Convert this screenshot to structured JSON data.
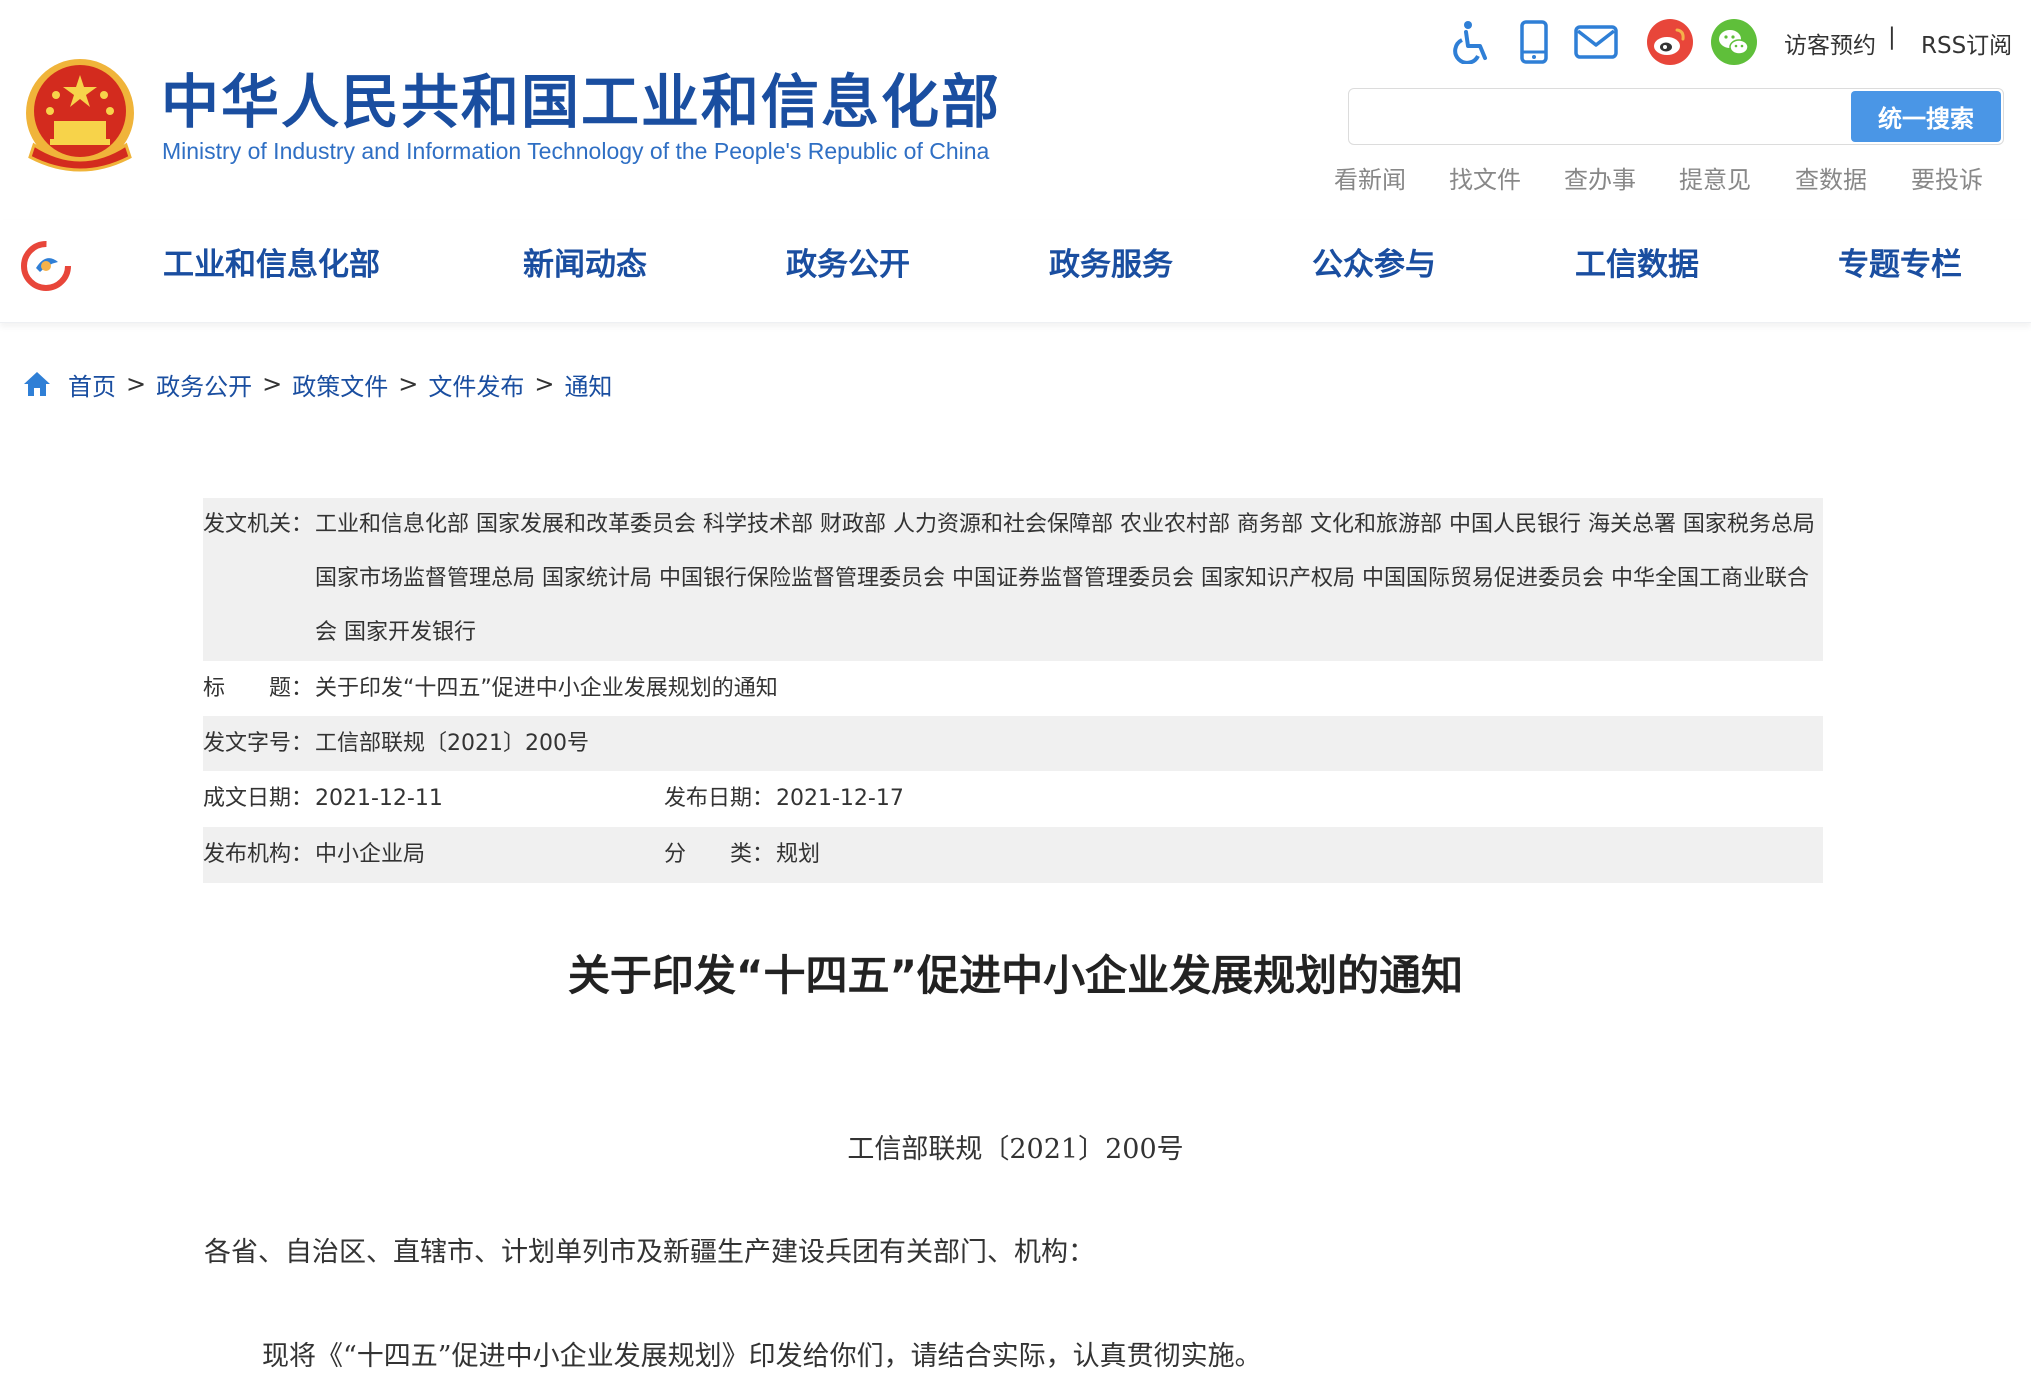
{
  "header": {
    "title": "中华人民共和国工业和信息化部",
    "subtitle": "Ministry of Industry and Information Technology of the People's Republic of China",
    "tools": {
      "icons": [
        "accessibility-icon",
        "mobile-icon",
        "mail-icon",
        "weibo-icon",
        "wechat-icon"
      ],
      "visit": "访客预约",
      "separator": "|",
      "rss": "RSS订阅"
    },
    "search": {
      "placeholder": "",
      "button": "统一搜索"
    },
    "quick_links": [
      "看新闻",
      "找文件",
      "查办事",
      "提意见",
      "查数据",
      "要投诉"
    ]
  },
  "nav": {
    "items": [
      "工业和信息化部",
      "新闻动态",
      "政务公开",
      "政务服务",
      "公众参与",
      "工信数据",
      "专题专栏"
    ]
  },
  "breadcrumb": {
    "items": [
      "首页",
      "政务公开",
      "政策文件",
      "文件发布",
      "通知"
    ],
    "separator": ">"
  },
  "info": {
    "issuer_label": "发文机关：",
    "issuer_value": "工业和信息化部 国家发展和改革委员会 科学技术部 财政部 人力资源和社会保障部 农业农村部 商务部 文化和旅游部 中国人民银行 海关总署 国家税务总局 国家市场监督管理总局 国家统计局 中国银行保险监督管理委员会 中国证券监督管理委员会 国家知识产权局 中国国际贸易促进委员会 中华全国工商业联合会 国家开发银行",
    "title_label": "标　　题：",
    "title_value": "关于印发“十四五”促进中小企业发展规划的通知",
    "docno_label": "发文字号：",
    "docno_value": "工信部联规〔2021〕200号",
    "written_label": "成文日期：",
    "written_value": "2021-12-11",
    "published_label": "发布日期：",
    "published_value": "2021-12-17",
    "agency_label": "发布机构：",
    "agency_value": "中小企业局",
    "category_label": "分　　类：",
    "category_value": "规划"
  },
  "article": {
    "title": "关于印发“十四五”促进中小企业发展规划的通知",
    "doc_number": "工信部联规〔2021〕200号",
    "salutation": "各省、自治区、直辖市、计划单列市及新疆生产建设兵团有关部门、机构：",
    "body": "现将《“十四五”促进中小企业发展规划》印发给你们，请结合实际，认真贯彻实施。"
  },
  "colors": {
    "brand_blue": "#1a4ea0",
    "search_button": "#4a96e6",
    "shaded_row": "#f0f0f0"
  }
}
